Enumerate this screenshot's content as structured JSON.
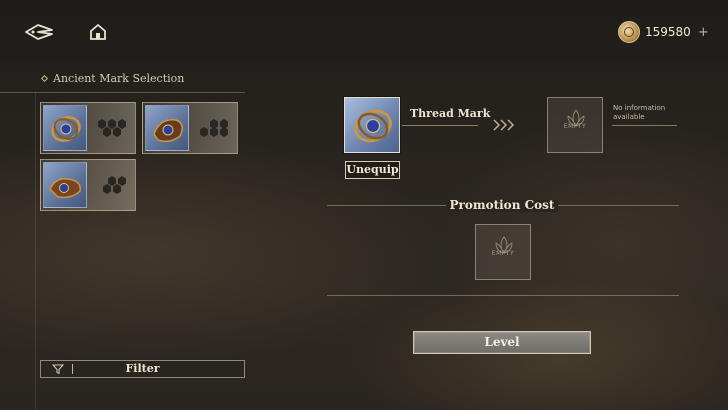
{
  "topbar": {
    "back_icon": "back-arrow-icon",
    "home_icon": "home-icon",
    "currency_amount": "159580",
    "currency_plus": "+"
  },
  "left_panel": {
    "title": "Ancient Mark Selection",
    "marks": [
      {
        "name": "mark-1",
        "selected": true
      },
      {
        "name": "mark-2",
        "selected": false
      },
      {
        "name": "mark-3",
        "selected": false
      }
    ],
    "filter_label": "Filter"
  },
  "right_panel": {
    "mark_name": "Thread Mark",
    "unequip_label": "Unequip",
    "target_empty_label": "EMPTY",
    "no_info": "No information available",
    "promotion_title": "Promotion Cost",
    "cost_empty_label": "EMPTY",
    "level_label": "Level"
  },
  "colors": {
    "background": "#2a2520",
    "accent_gold": "#cdb787",
    "text": "#efe6d2"
  }
}
